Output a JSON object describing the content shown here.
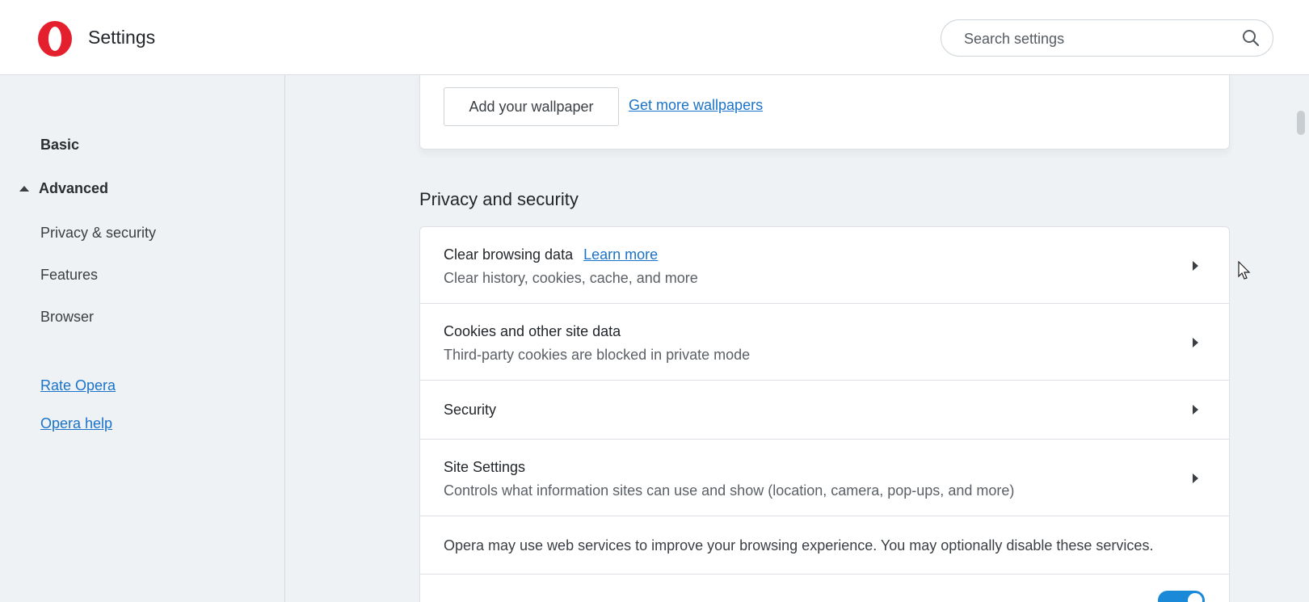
{
  "header": {
    "title": "Settings",
    "search": {
      "placeholder": "Search settings"
    }
  },
  "sidebar": {
    "items": [
      {
        "label": "Basic"
      },
      {
        "label": "Advanced"
      },
      {
        "label": "Privacy & security"
      },
      {
        "label": "Features"
      },
      {
        "label": "Browser"
      }
    ],
    "links": [
      {
        "label": "Rate Opera"
      },
      {
        "label": "Opera help"
      }
    ]
  },
  "wallpaper": {
    "add_button": "Add your wallpaper",
    "more_link": "Get more wallpapers"
  },
  "privacy": {
    "section_title": "Privacy and security",
    "rows": [
      {
        "title": "Clear browsing data",
        "link": "Learn more",
        "subtitle": "Clear history, cookies, cache, and more"
      },
      {
        "title": "Cookies and other site data",
        "subtitle": "Third-party cookies are blocked in private mode"
      },
      {
        "title": "Security"
      },
      {
        "title": "Site Settings",
        "subtitle": "Controls what information sites can use and show (location, camera, pop-ups, and more)"
      }
    ],
    "note": "Opera may use web services to improve your browsing experience. You may optionally disable these services."
  },
  "colors": {
    "accent": "#1a73c8",
    "brand": "#e4202e",
    "toggle_on": "#1a8ad8"
  },
  "icons": {
    "logo": "opera-logo",
    "search": "search-icon",
    "expand": "caret-up-icon",
    "row_arrow": "chevron-right-icon"
  }
}
